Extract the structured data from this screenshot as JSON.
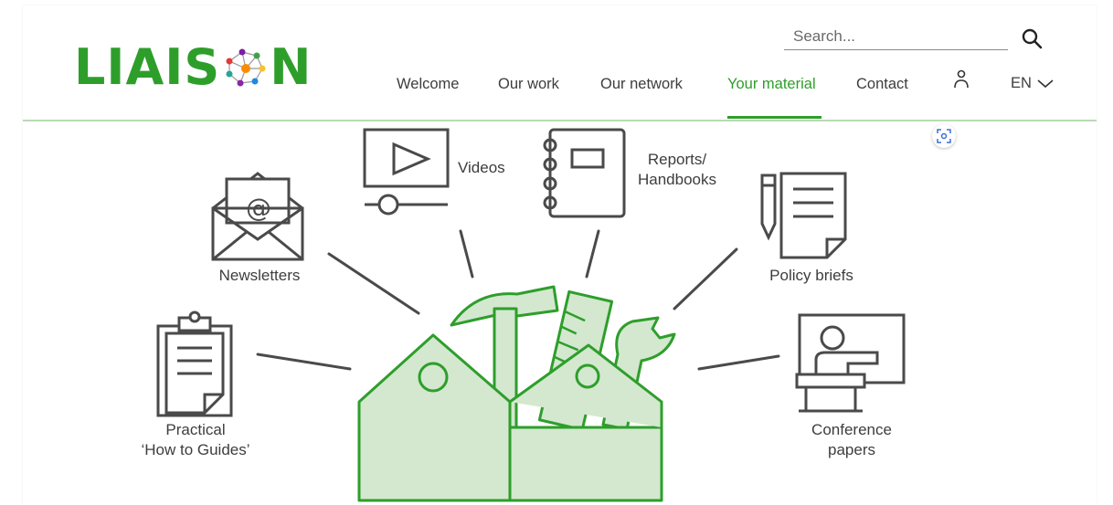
{
  "header": {
    "logo": {
      "text_left": "LIAIS",
      "text_right": "N",
      "brand_color": "#2e9e2b"
    },
    "search": {
      "placeholder": "Search...",
      "icon": "search-icon"
    },
    "nav": [
      {
        "label": "Welcome"
      },
      {
        "label": "Our work"
      },
      {
        "label": "Our network"
      },
      {
        "label": "Your material",
        "active": true
      },
      {
        "label": "Contact"
      }
    ],
    "user_icon": "user-icon",
    "language": {
      "selected": "EN",
      "icon": "chevron-down-icon"
    }
  },
  "illustration": {
    "accent_color": "#2e9e2b",
    "fill_color": "#d3e8cf",
    "items": [
      {
        "label": "Videos",
        "icon": "video-player-icon"
      },
      {
        "label_line1": "Reports/",
        "label_line2": "Handbooks",
        "icon": "notebook-icon"
      },
      {
        "label": "Newsletters",
        "icon": "envelope-icon"
      },
      {
        "label": "Policy briefs",
        "icon": "document-pencil-icon"
      },
      {
        "label_line1": "Practical",
        "label_line2": "‘How to Guides’",
        "icon": "clipboard-icon"
      },
      {
        "label_line1": "Conference",
        "label_line2": "papers",
        "icon": "presenter-icon"
      }
    ],
    "center_icon": "toolbox-icon"
  }
}
